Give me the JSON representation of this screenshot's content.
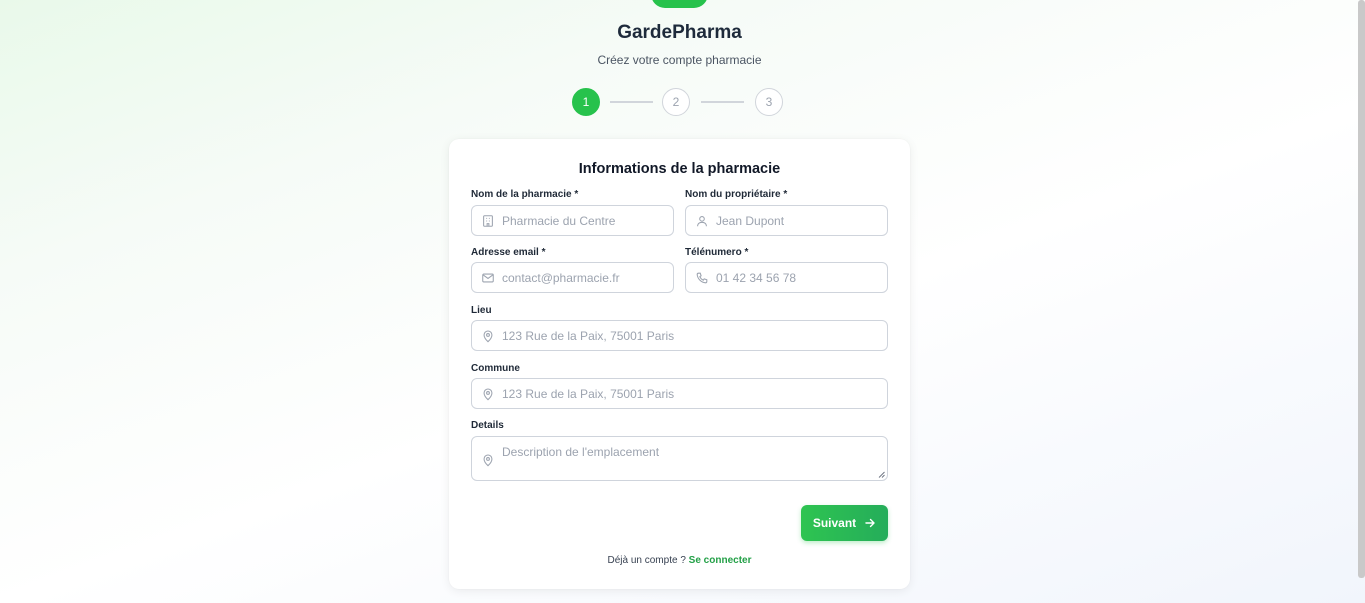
{
  "brand": {
    "name": "GardePharma",
    "subtitle": "Créez votre compte pharmacie"
  },
  "stepper": {
    "steps": [
      "1",
      "2",
      "3"
    ],
    "current_step": 1
  },
  "form": {
    "title": "Informations de la pharmacie",
    "pharmacy_name": {
      "label": "Nom de la pharmacie *",
      "placeholder": "Pharmacie du Centre",
      "icon": "building-icon"
    },
    "owner_name": {
      "label": "Nom du propriétaire *",
      "placeholder": "Jean Dupont",
      "icon": "user-icon"
    },
    "email": {
      "label": "Adresse email *",
      "placeholder": "contact@pharmacie.fr",
      "icon": "mail-icon"
    },
    "phone": {
      "label": "Télénumero *",
      "placeholder": "01 42 34 56 78",
      "icon": "phone-icon"
    },
    "lieu": {
      "label": "Lieu",
      "placeholder": "123 Rue de la Paix, 75001 Paris",
      "icon": "map-pin-icon"
    },
    "commune": {
      "label": "Commune",
      "placeholder": "123 Rue de la Paix, 75001 Paris",
      "icon": "map-pin-icon"
    },
    "details": {
      "label": "Details",
      "placeholder": "Description de l'emplacement",
      "icon": "map-pin-icon"
    },
    "next_button": "Suivant",
    "footer_text": "Déjà un compte ?",
    "login_link": "Se connecter"
  },
  "colors": {
    "accent": "#27c24c",
    "link": "#23a047",
    "border": "#cfd4dc"
  }
}
